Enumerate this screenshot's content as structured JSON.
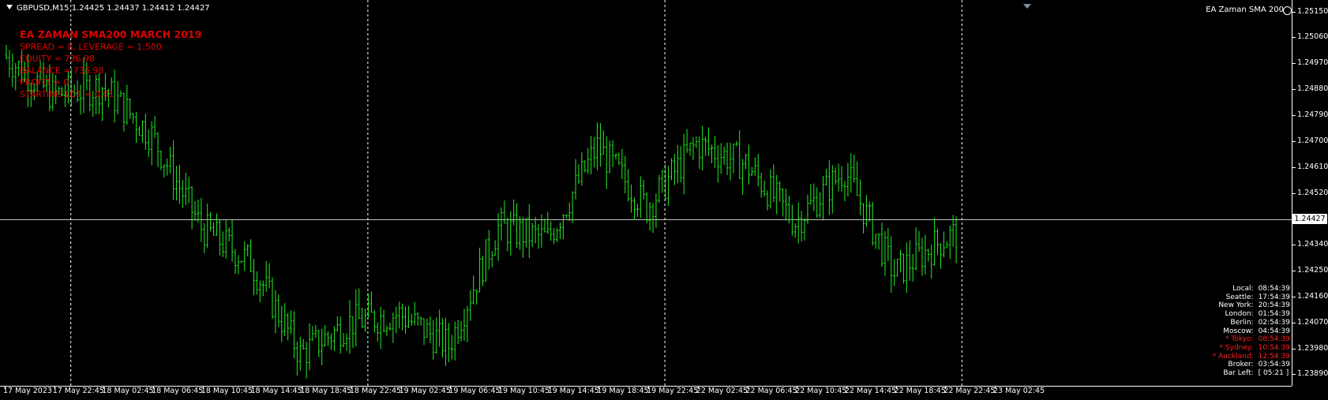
{
  "header": {
    "symbol_line": "GBPUSD,M15  1.24425 1.24437 1.24412 1.24427"
  },
  "ea": {
    "name": "EA Zaman SMA 200"
  },
  "info": {
    "title": "EA ZAMAN SMA200 MARCH 2019",
    "lines": [
      "SPREAD = 8, LEVERAGE = 1:500",
      "EQUITY = 736.98",
      "BALANCE = 736.98",
      "PROFIT = 0",
      "STARTING LOT = 0.01"
    ]
  },
  "current_price": "1.24427",
  "price_axis": [
    "1.25150",
    "1.25060",
    "1.24970",
    "1.24880",
    "1.24790",
    "1.24700",
    "1.24610",
    "1.24520",
    "1.24340",
    "1.24250",
    "1.24160",
    "1.24070",
    "1.23980",
    "1.23890"
  ],
  "time_axis": [
    "17 May 2023",
    "17 May 22:45",
    "18 May 02:45",
    "18 May 06:45",
    "18 May 10:45",
    "18 May 14:45",
    "18 May 18:45",
    "18 May 22:45",
    "19 May 02:45",
    "19 May 06:45",
    "19 May 10:45",
    "19 May 14:45",
    "19 May 18:45",
    "19 May 22:45",
    "22 May 02:45",
    "22 May 06:45",
    "22 May 10:45",
    "22 May 14:45",
    "22 May 18:45",
    "22 May 22:45",
    "23 May 02:45"
  ],
  "clock": {
    "rows": [
      {
        "city": "Local:",
        "time": "08:54:39",
        "red": false
      },
      {
        "city": "Seattle:",
        "time": "17:54:39",
        "red": false
      },
      {
        "city": "New York:",
        "time": "20:54:39",
        "red": false
      },
      {
        "city": "London:",
        "time": "01:54:39",
        "red": false
      },
      {
        "city": "Berlin:",
        "time": "02:54:39",
        "red": false
      },
      {
        "city": "Moscow:",
        "time": "04:54:39",
        "red": false
      },
      {
        "city": "* Tokyo:",
        "time": "08:54:39",
        "red": true
      },
      {
        "city": "* Sydney:",
        "time": "10:54:39",
        "red": true
      },
      {
        "city": "* Auckland:",
        "time": "12:54:39",
        "red": true
      },
      {
        "city": "Broker:",
        "time": "03:54:39",
        "red": false
      },
      {
        "city": "Bar Left:",
        "time": "[ 05:21 ]",
        "red": false
      }
    ]
  },
  "colors": {
    "bars": "#22ee22",
    "background": "#000000",
    "grid": "#ffffff",
    "text": "#ffffff",
    "info": "#e00000"
  },
  "chart_data": {
    "type": "line",
    "title": "",
    "series_note": "",
    "ylim": [
      1.2385,
      1.2519
    ],
    "x": [
      "17 May 2023",
      "17 May 22:45",
      "18 May 02:45",
      "18 May 06:45",
      "18 May 10:45",
      "18 May 14:45",
      "18 May 18:45",
      "18 May 22:45",
      "19 May 02:45",
      "19 May 06:45",
      "19 May 10:45",
      "19 May 14:45",
      "19 May 18:45",
      "19 May 22:45",
      "22 May 02:45",
      "22 May 06:45",
      "22 May 10:45",
      "22 May 14:45",
      "22 May 18:45",
      "22 May 22:45",
      "23 May 02:45"
    ],
    "close": [
      1.25,
      1.2486,
      1.2489,
      1.2472,
      1.244,
      1.2428,
      1.2396,
      1.2407,
      1.241,
      1.2399,
      1.244,
      1.2436,
      1.2468,
      1.2447,
      1.2469,
      1.2462,
      1.2442,
      1.246,
      1.2424,
      1.2436,
      1.24427
    ]
  }
}
